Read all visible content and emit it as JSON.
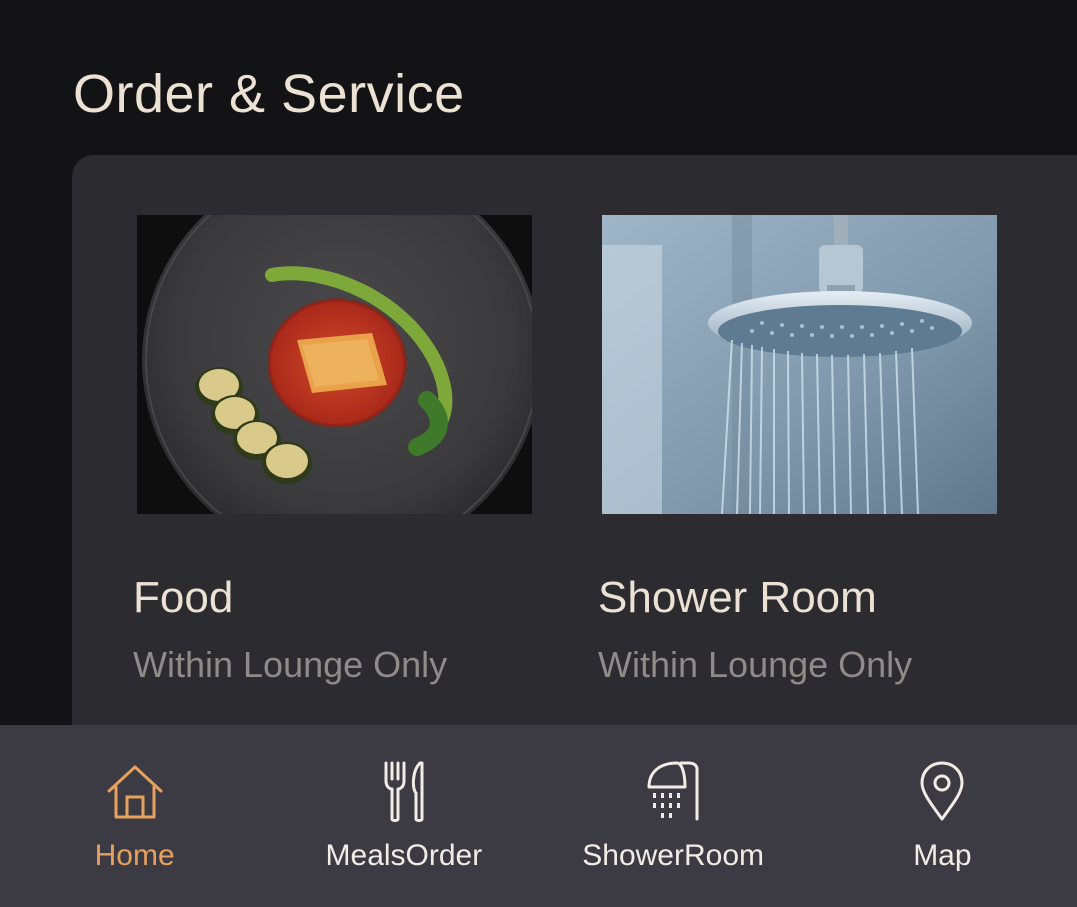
{
  "header": {
    "title": "Order & Service"
  },
  "services": [
    {
      "title": "Food",
      "subtitle": "Within Lounge Only",
      "image": "plated-dish-photo"
    },
    {
      "title": "Shower Room",
      "subtitle": "Within Lounge Only",
      "image": "rain-shower-head-photo"
    }
  ],
  "tabbar": {
    "active_index": 0,
    "active_color": "#e6a15c",
    "inactive_color": "#f1ece6",
    "items": [
      {
        "label": "Home",
        "icon": "home-icon"
      },
      {
        "label": "MealsOrder",
        "icon": "fork-knife-icon"
      },
      {
        "label": "ShowerRoom",
        "icon": "shower-icon"
      },
      {
        "label": "Map",
        "icon": "map-pin-icon"
      }
    ]
  }
}
